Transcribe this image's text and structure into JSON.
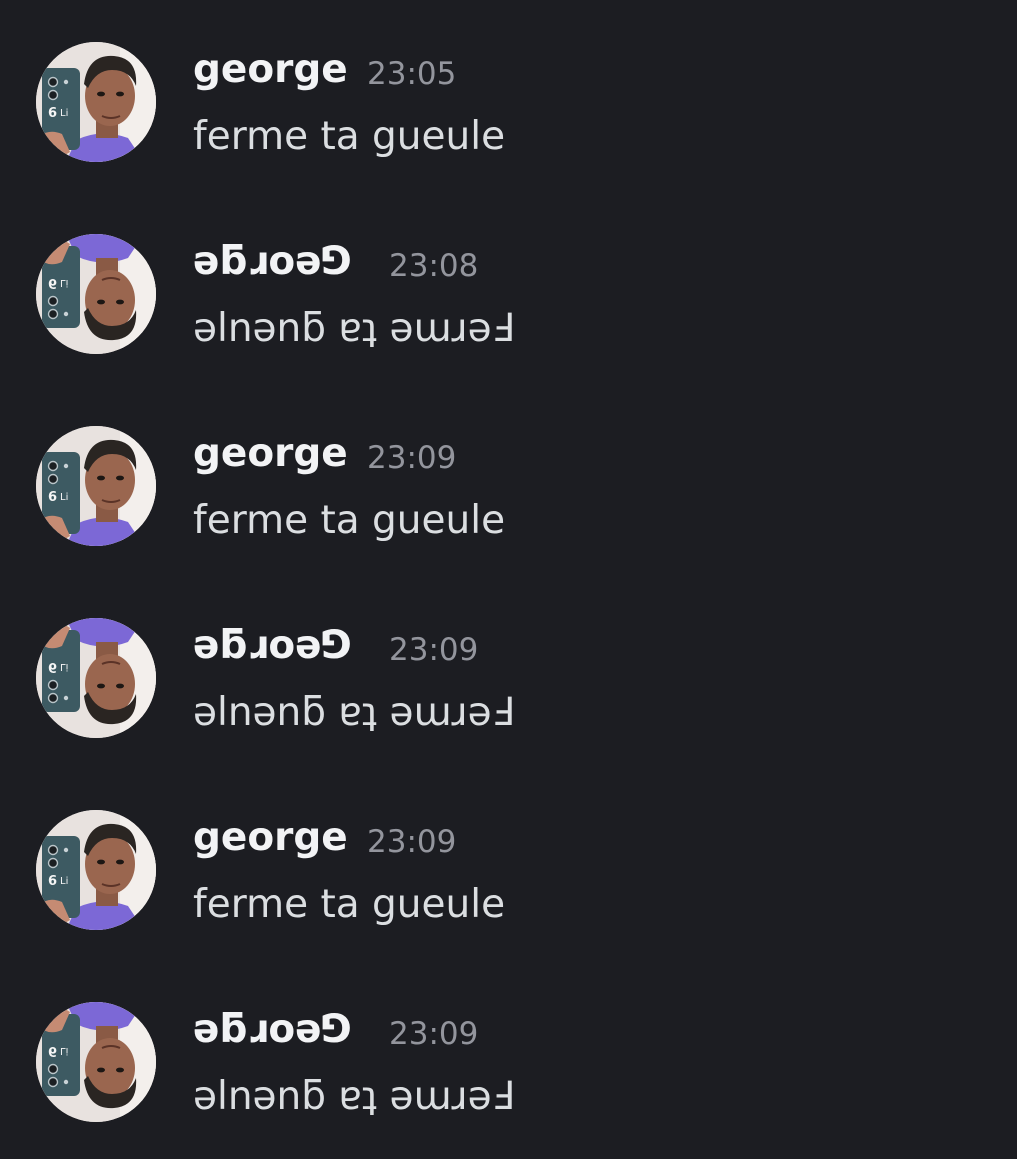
{
  "messages": [
    {
      "author": "george",
      "time": "23:05",
      "text": "ferme ta gueule"
    },
    {
      "author": "ǝƃɹoǝ⅁",
      "time": "23:08",
      "text": "ǝlnǝnƃ ɐʇ ǝɯɹǝℲ"
    },
    {
      "author": "george",
      "time": "23:09",
      "text": "ferme ta gueule"
    },
    {
      "author": "ǝƃɹoǝ⅁",
      "time": "23:09",
      "text": "ǝlnǝnƃ ɐʇ ǝɯɹǝℲ"
    },
    {
      "author": "george",
      "time": "23:09",
      "text": "ferme ta gueule"
    },
    {
      "author": "ǝƃɹoǝ⅁",
      "time": "23:09",
      "text": "ǝlnǝnƃ ɐʇ ǝɯɹǝℲ"
    }
  ],
  "colors": {
    "background": "#1c1d22",
    "username": "#f2f3f5",
    "timestamp": "#93959d",
    "message_text": "#dbdee1"
  },
  "icons": {
    "avatar": "user-avatar-photo"
  }
}
